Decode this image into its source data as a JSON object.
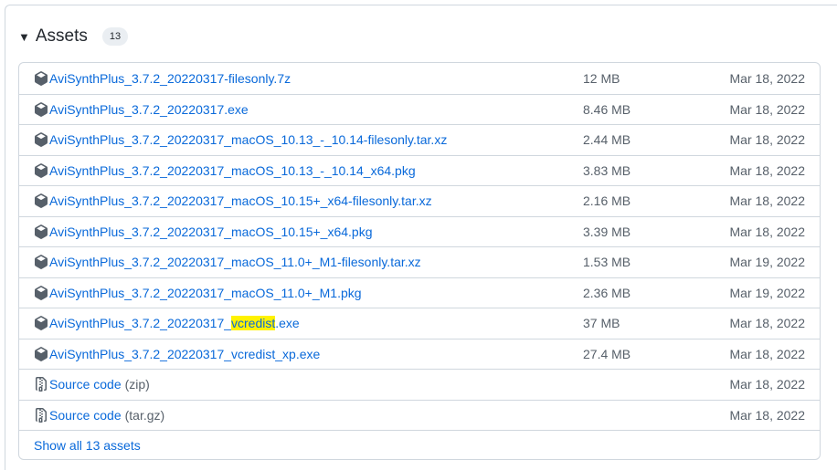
{
  "header": {
    "title": "Assets",
    "count": "13"
  },
  "assets": [
    {
      "name": "AviSynthPlus_3.7.2_20220317-filesonly.7z",
      "size": "12 MB",
      "date": "Mar 18, 2022"
    },
    {
      "name": "AviSynthPlus_3.7.2_20220317.exe",
      "size": "8.46 MB",
      "date": "Mar 18, 2022"
    },
    {
      "name": "AviSynthPlus_3.7.2_20220317_macOS_10.13_-_10.14-filesonly.tar.xz",
      "size": "2.44 MB",
      "date": "Mar 18, 2022"
    },
    {
      "name": "AviSynthPlus_3.7.2_20220317_macOS_10.13_-_10.14_x64.pkg",
      "size": "3.83 MB",
      "date": "Mar 18, 2022"
    },
    {
      "name": "AviSynthPlus_3.7.2_20220317_macOS_10.15+_x64-filesonly.tar.xz",
      "size": "2.16 MB",
      "date": "Mar 18, 2022"
    },
    {
      "name": "AviSynthPlus_3.7.2_20220317_macOS_10.15+_x64.pkg",
      "size": "3.39 MB",
      "date": "Mar 18, 2022"
    },
    {
      "name": "AviSynthPlus_3.7.2_20220317_macOS_11.0+_M1-filesonly.tar.xz",
      "size": "1.53 MB",
      "date": "Mar 19, 2022"
    },
    {
      "name": "AviSynthPlus_3.7.2_20220317_macOS_11.0+_M1.pkg",
      "size": "2.36 MB",
      "date": "Mar 19, 2022"
    },
    {
      "name_prefix": "AviSynthPlus_3.7.2_20220317_",
      "name_highlight": "vcredist",
      "name_suffix": ".exe",
      "size": "37 MB",
      "date": "Mar 18, 2022"
    },
    {
      "name": "AviSynthPlus_3.7.2_20220317_vcredist_xp.exe",
      "size": "27.4 MB",
      "date": "Mar 18, 2022"
    }
  ],
  "sources": [
    {
      "label": "Source code",
      "suffix": "(zip)",
      "date": "Mar 18, 2022"
    },
    {
      "label": "Source code",
      "suffix": "(tar.gz)",
      "date": "Mar 18, 2022"
    }
  ],
  "footer": {
    "show_all": "Show all 13 assets"
  },
  "icons": {
    "package": "package-icon",
    "zip": "file-zip-icon",
    "caret": "triangle-down-icon"
  },
  "colors": {
    "link": "#0969da",
    "muted": "#57606a",
    "border": "#d0d7de",
    "highlight": "#fff200"
  }
}
